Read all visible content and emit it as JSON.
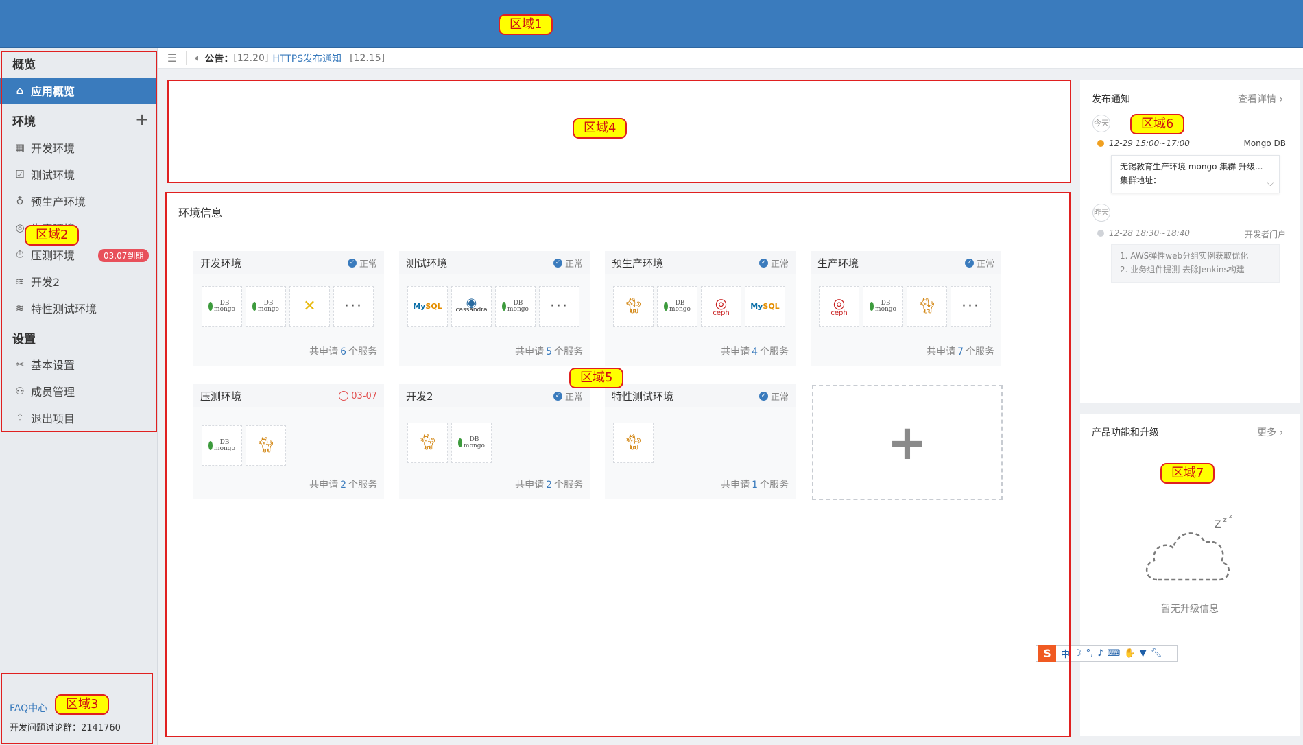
{
  "regions": {
    "r1": "区域1",
    "r2": "区域2",
    "r3": "区域3",
    "r4": "区域4",
    "r5": "区域5",
    "r6": "区域6",
    "r7": "区域7"
  },
  "sidebar": {
    "overview_section": "概览",
    "app_overview": "应用概览",
    "env_section": "环境",
    "env_items": [
      "开发环境",
      "测试环境",
      "预生产环境",
      "生产环境",
      "压测环境",
      "开发2",
      "特性测试环境"
    ],
    "stress_badge": "03.07到期",
    "settings_section": "设置",
    "settings_items": [
      "基本设置",
      "成员管理",
      "退出项目"
    ],
    "faq": "FAQ中心",
    "dev_group": "开发问题讨论群：2141760"
  },
  "notice": {
    "label": "公告：",
    "date1": "[12.20]",
    "link": "HTTPS发布通知",
    "date2": "[12.15]"
  },
  "env_info": {
    "title": "环境信息",
    "status_ok": "正常",
    "foot_prefix": "共申请",
    "foot_suffix": "个服务",
    "cards": [
      {
        "name": "开发环境",
        "status": "正常",
        "count": "6",
        "services": [
          "mongodb",
          "mongodb",
          "spring",
          "more-icon"
        ]
      },
      {
        "name": "测试环境",
        "status": "正常",
        "count": "5",
        "services": [
          "mysql",
          "cassandra",
          "mongodb",
          "more-icon"
        ]
      },
      {
        "name": "预生产环境",
        "status": "正常",
        "count": "4",
        "services": [
          "tomcat",
          "mongodb",
          "ceph",
          "mysql"
        ]
      },
      {
        "name": "生产环境",
        "status": "正常",
        "count": "7",
        "services": [
          "ceph",
          "mongodb",
          "tomcat",
          "more-icon"
        ]
      },
      {
        "name": "压测环境",
        "status": "03-07",
        "count": "2",
        "services": [
          "mongodb",
          "tomcat"
        ]
      },
      {
        "name": "开发2",
        "status": "正常",
        "count": "2",
        "services": [
          "tomcat",
          "mongodb"
        ]
      },
      {
        "name": "特性测试环境",
        "status": "正常",
        "count": "1",
        "services": [
          "tomcat"
        ]
      }
    ]
  },
  "release": {
    "title": "发布通知",
    "more": "查看详情",
    "today": "今天",
    "yesterday": "昨天",
    "item1_time": "12-29 15:00~17:00",
    "item1_src": "Mongo DB",
    "item1_line1": "无锡教育生产环境 mongo 集群 升级...",
    "item1_line2": "集群地址：",
    "item2_time": "12-28 18:30~18:40",
    "item2_src": "开发者门户",
    "item2_line1": "1. AWS弹性web分组实例获取优化",
    "item2_line2": "2. 业务组件提测 去除Jenkins构建"
  },
  "upgrade": {
    "title": "产品功能和升级",
    "more": "更多",
    "empty": "暂无升级信息"
  },
  "ime": {
    "lang": "中"
  },
  "colors": {
    "primary": "#3a7bbd",
    "warn": "#e25050",
    "region_border": "#e02020",
    "region_label_bg": "#ffff00"
  }
}
